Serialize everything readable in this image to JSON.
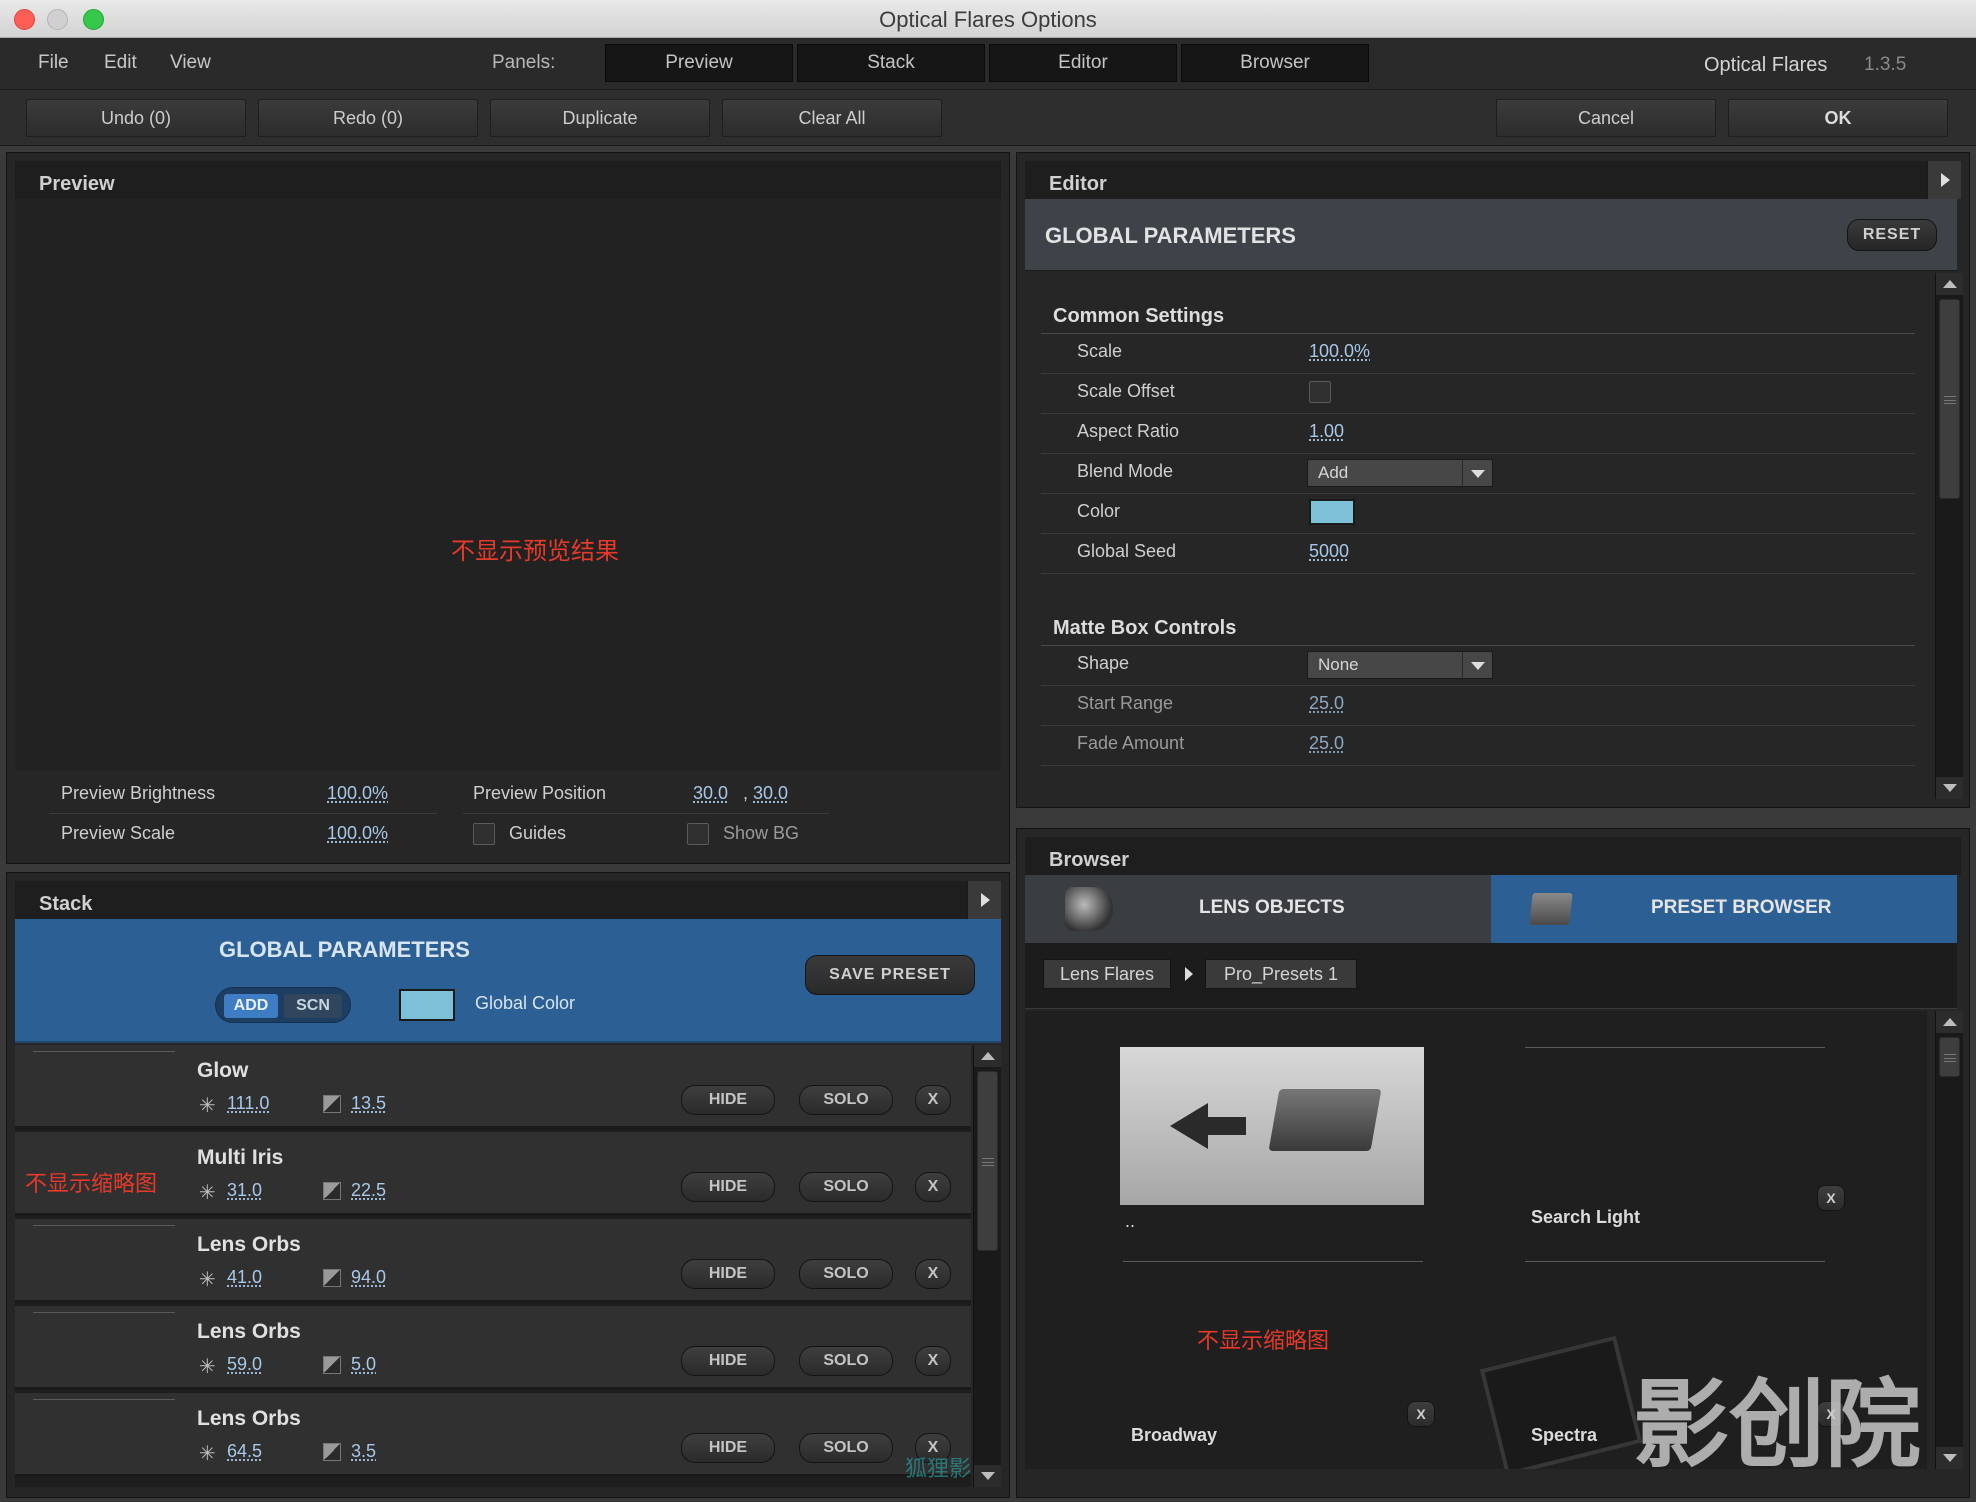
{
  "window": {
    "title": "Optical Flares Options"
  },
  "menu": {
    "file": "File",
    "edit": "Edit",
    "view": "View"
  },
  "panels_bar": {
    "label": "Panels:",
    "tabs": [
      "Preview",
      "Stack",
      "Editor",
      "Browser"
    ],
    "brand": "Optical Flares",
    "version": "1.3.5"
  },
  "toolbar": {
    "undo": "Undo (0)",
    "redo": "Redo (0)",
    "duplicate": "Duplicate",
    "clear_all": "Clear All",
    "cancel": "Cancel",
    "ok": "OK"
  },
  "preview": {
    "title": "Preview",
    "note": "不显示预览结果",
    "brightness_label": "Preview Brightness",
    "brightness_value": "100.0%",
    "position_label": "Preview Position",
    "position_x": "30.0",
    "position_y": "30.0",
    "scale_label": "Preview Scale",
    "scale_value": "100.0%",
    "guides_label": "Guides",
    "show_bg_label": "Show BG"
  },
  "stack": {
    "title": "Stack",
    "global_title": "GLOBAL PARAMETERS",
    "add_label": "ADD",
    "scn_label": "SCN",
    "global_color_label": "Global Color",
    "save_preset": "SAVE PRESET",
    "thumb_note": "不显示缩略图",
    "hide_label": "HIDE",
    "solo_label": "SOLO",
    "x_label": "X",
    "items": [
      {
        "name": "Glow",
        "brightness": "111.0",
        "scale": "13.5"
      },
      {
        "name": "Multi Iris",
        "brightness": "31.0",
        "scale": "22.5"
      },
      {
        "name": "Lens Orbs",
        "brightness": "41.0",
        "scale": "94.0"
      },
      {
        "name": "Lens Orbs",
        "brightness": "59.0",
        "scale": "5.0"
      },
      {
        "name": "Lens Orbs",
        "brightness": "64.5",
        "scale": "3.5"
      }
    ]
  },
  "editor": {
    "title": "Editor",
    "global_title": "GLOBAL PARAMETERS",
    "reset": "RESET",
    "common": {
      "title": "Common Settings",
      "scale_label": "Scale",
      "scale_value": "100.0%",
      "offset_label": "Scale Offset",
      "aspect_label": "Aspect Ratio",
      "aspect_value": "1.00",
      "blend_label": "Blend Mode",
      "blend_value": "Add",
      "color_label": "Color",
      "seed_label": "Global Seed",
      "seed_value": "5000"
    },
    "matte": {
      "title": "Matte Box Controls",
      "shape_label": "Shape",
      "shape_value": "None",
      "start_label": "Start Range",
      "start_value": "25.0",
      "fade_label": "Fade Amount",
      "fade_value": "25.0"
    },
    "color_swatch": "#7ec0d8"
  },
  "browser": {
    "title": "Browser",
    "tab_lens": "LENS OBJECTS",
    "tab_preset": "PRESET BROWSER",
    "crumb_1": "Lens Flares",
    "crumb_2": "Pro_Presets 1",
    "back_label": "..",
    "search_light": "Search Light",
    "broadway": "Broadway",
    "spectra": "Spectra",
    "thumb_note": "不显示缩略图",
    "x_label": "X"
  },
  "watermarks": {
    "big": "影创院",
    "small": "狐狸影视城"
  },
  "colors": {
    "accent_blue": "#2c5f94",
    "note_red": "#e53a2a",
    "value_blue": "#a8c8e8"
  }
}
